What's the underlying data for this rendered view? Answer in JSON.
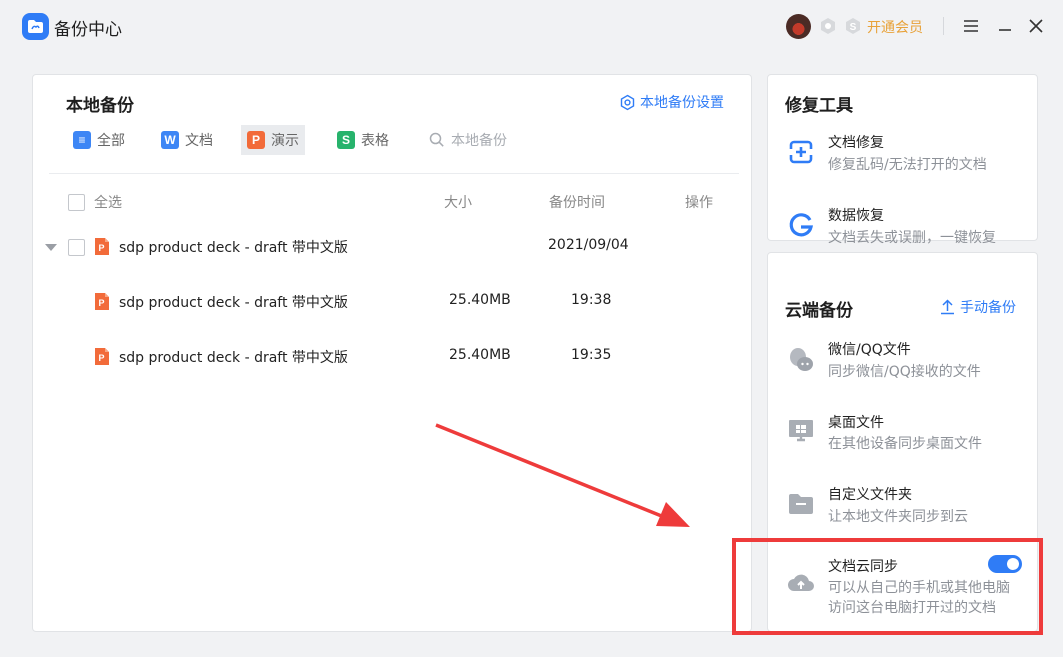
{
  "app": {
    "title": "备份中心",
    "vip_label": "开通会员"
  },
  "local_backup": {
    "title": "本地备份",
    "settings_label": "本地备份设置",
    "tabs": [
      {
        "label": "全部",
        "icon": "list-icon"
      },
      {
        "label": "文档",
        "icon": "word-icon"
      },
      {
        "label": "演示",
        "icon": "ppt-icon",
        "active": true
      },
      {
        "label": "表格",
        "icon": "sheet-icon"
      }
    ],
    "search_placeholder": "本地备份",
    "columns": {
      "select_all": "全选",
      "size": "大小",
      "time": "备份时间",
      "action": "操作"
    },
    "group": {
      "name": "sdp product deck - draft 带中文版",
      "date": "2021/09/04"
    },
    "rows": [
      {
        "name": "sdp product deck - draft 带中文版",
        "size": "25.40MB",
        "time": "19:38"
      },
      {
        "name": "sdp product deck - draft 带中文版",
        "size": "25.40MB",
        "time": "19:35"
      }
    ]
  },
  "repair": {
    "title": "修复工具",
    "items": [
      {
        "title": "文档修复",
        "desc": "修复乱码/无法打开的文档"
      },
      {
        "title": "数据恢复",
        "desc": "文档丢失或误删，一键恢复"
      }
    ]
  },
  "cloud": {
    "title": "云端备份",
    "manual_label": "手动备份",
    "items": [
      {
        "title": "微信/QQ文件",
        "desc": "同步微信/QQ接收的文件"
      },
      {
        "title": "桌面文件",
        "desc": "在其他设备同步桌面文件"
      },
      {
        "title": "自定义文件夹",
        "desc": "让本地文件夹同步到云"
      },
      {
        "title": "文档云同步",
        "desc1": "可以从自己的手机或其他电脑",
        "desc2": "访问这台电脑打开过的文档",
        "enabled": true
      }
    ]
  },
  "colors": {
    "accent": "#2f7cf6",
    "vip": "#e8a23a",
    "annotation": "#ee3b3b",
    "ppt": "#f26b3a",
    "sheet": "#27b36c"
  }
}
